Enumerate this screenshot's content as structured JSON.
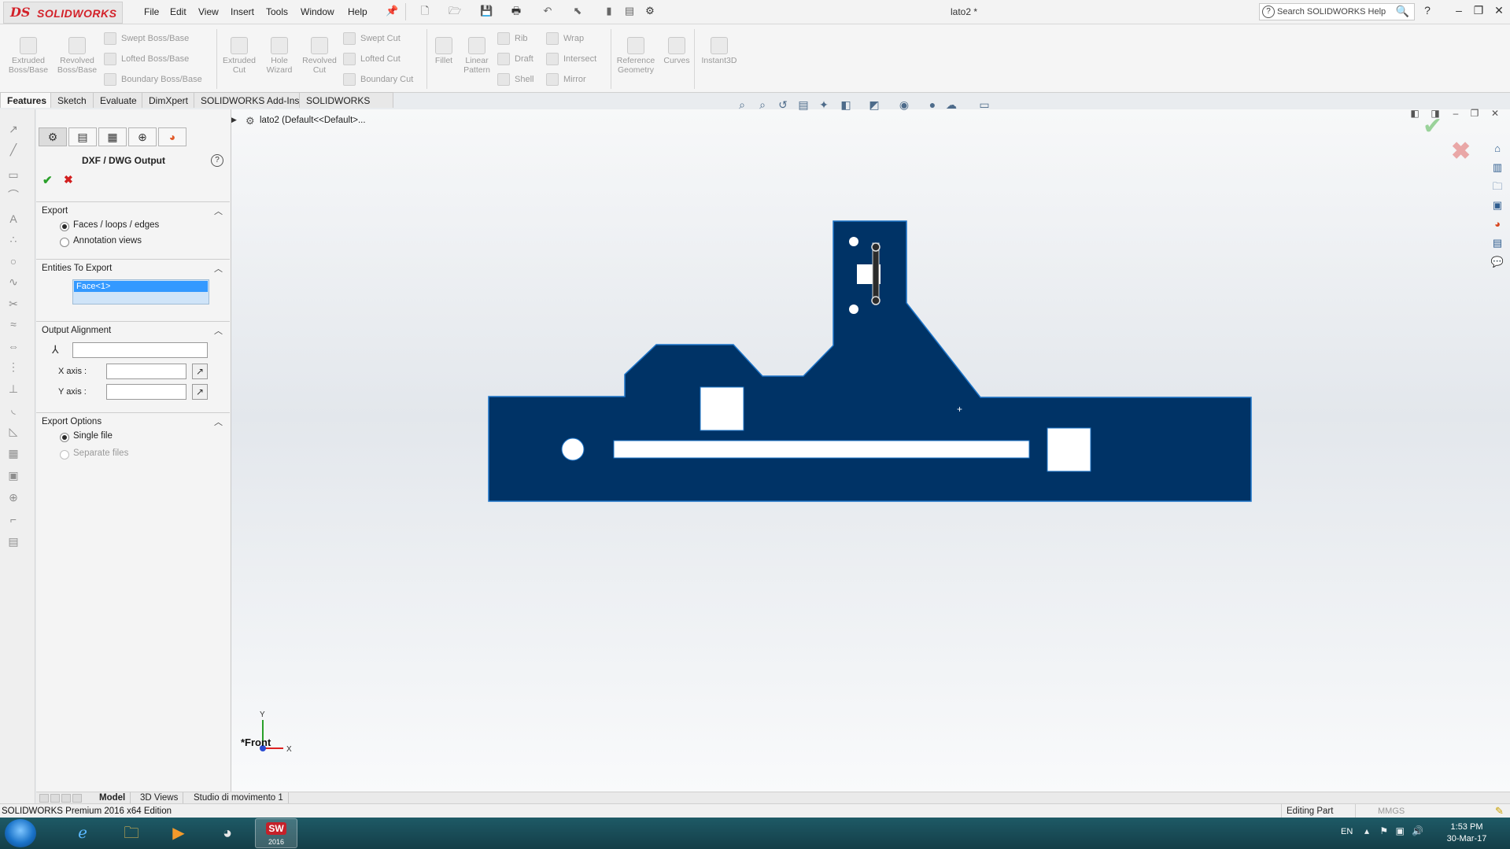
{
  "app": {
    "brand_mark": "DS",
    "brand_name": "SOLIDWORKS",
    "document_title": "lato2 *",
    "search_placeholder": "Search SOLIDWORKS Help"
  },
  "menu": [
    "File",
    "Edit",
    "View",
    "Insert",
    "Tools",
    "Window",
    "Help"
  ],
  "command_manager": {
    "groups": [
      {
        "label_lines": [
          "Extruded",
          "Boss/Base"
        ]
      },
      {
        "label_lines": [
          "Revolved",
          "Boss/Base"
        ]
      },
      {
        "label_lines": [
          "Extruded",
          "Cut"
        ]
      },
      {
        "label_lines": [
          "Hole",
          "Wizard"
        ]
      },
      {
        "label_lines": [
          "Revolved",
          "Cut"
        ]
      },
      {
        "label_lines": [
          "Fillet"
        ]
      },
      {
        "label_lines": [
          "Linear",
          "Pattern"
        ]
      },
      {
        "label_lines": [
          "Reference",
          "Geometry"
        ]
      },
      {
        "label_lines": [
          "Curves"
        ]
      },
      {
        "label_lines": [
          "Instant3D"
        ]
      }
    ],
    "small_items": [
      "Swept Boss/Base",
      "Lofted Boss/Base",
      "Boundary Boss/Base",
      "Swept Cut",
      "Lofted Cut",
      "Boundary Cut",
      "Rib",
      "Draft",
      "Shell",
      "Wrap",
      "Intersect",
      "Mirror"
    ]
  },
  "tabs": [
    "Features",
    "Sketch",
    "Evaluate",
    "DimXpert",
    "SOLIDWORKS Add-Ins",
    "SOLIDWORKS MBD"
  ],
  "property_manager": {
    "title": "DXF / DWG Output",
    "help": "?",
    "export": {
      "header": "Export",
      "options": [
        "Faces / loops / edges",
        "Annotation views"
      ],
      "selected": "Faces / loops / edges"
    },
    "entities": {
      "header": "Entities To Export",
      "items": [
        "Face<1>"
      ]
    },
    "alignment": {
      "header": "Output Alignment",
      "x_label": "X axis :",
      "y_label": "Y axis :"
    },
    "export_options": {
      "header": "Export Options",
      "options": [
        "Single file",
        "Separate files"
      ],
      "selected": "Single file"
    }
  },
  "graphics": {
    "tree_item": "lato2  (Default<<Default>...",
    "view_name": "*Front",
    "triad_y": "Y",
    "triad_x": "X",
    "part_color": "#003366"
  },
  "model_tabs": [
    "Model",
    "3D Views",
    "Studio di movimento 1"
  ],
  "status_bar": {
    "product": "SOLIDWORKS Premium 2016 x64 Edition",
    "mode": "Editing Part",
    "units": "MMGS"
  },
  "taskbar": {
    "sw_badge": "2016",
    "lang": "EN",
    "time": "1:53 PM",
    "date": "30-Mar-17"
  }
}
